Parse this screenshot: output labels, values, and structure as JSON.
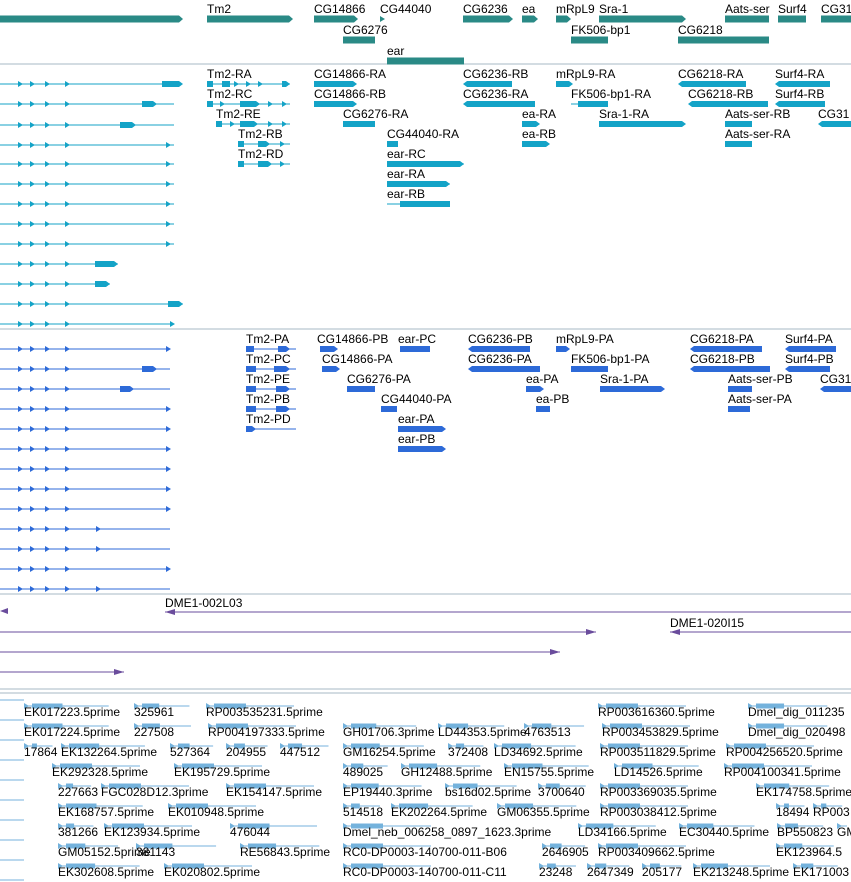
{
  "colors": {
    "gene": "#2a8a86",
    "flybase_tx": "#14a3c7",
    "predicted_tx": "#2d6ad8",
    "clone": "#6a4c9c",
    "est": "#74b2dc",
    "divider": "#a7b9c4",
    "line": "#000000"
  },
  "gene_track": {
    "labels": [
      "Tm2",
      "CG14866",
      "CG44040",
      "CG6236",
      "ea",
      "mRpL9",
      "Sra-1",
      "Aats-ser",
      "Surf4",
      "CG31",
      "CG6276",
      "FK506-bp1",
      "CG6218",
      "ear"
    ]
  },
  "flybase_track": {
    "labels": [
      "Tm2-RA",
      "CG14866-RA",
      "CG6236-RB",
      "mRpL9-RA",
      "CG6218-RA",
      "Surf4-RA",
      "Tm2-RC",
      "CG14866-RB",
      "CG6236-RA",
      "FK506-bp1-RA",
      "CG6218-RB",
      "Surf4-RB",
      "Tm2-RE",
      "CG6276-RA",
      "ea-RA",
      "Sra-1-RA",
      "Aats-ser-RB",
      "CG31",
      "Tm2-RB",
      "CG44040-RA",
      "ea-RB",
      "Aats-ser-RA",
      "Tm2-RD",
      "ear-RC",
      "ear-RA",
      "ear-RB"
    ]
  },
  "predicted_track": {
    "labels": [
      "Tm2-PA",
      "CG14866-PB",
      "ear-PC",
      "CG6236-PB",
      "mRpL9-PA",
      "CG6218-PA",
      "Surf4-PA",
      "Tm2-PC",
      "CG14866-PA",
      "CG6236-PA",
      "FK506-bp1-PA",
      "CG6218-PB",
      "Surf4-PB",
      "Tm2-PE",
      "CG6276-PA",
      "ea-PA",
      "Sra-1-PA",
      "Aats-ser-PB",
      "CG31",
      "Tm2-PB",
      "CG44040-PA",
      "ea-PB",
      "Aats-ser-PA",
      "Tm2-PD",
      "ear-PA",
      "ear-PB"
    ]
  },
  "clone_track": {
    "labels": [
      "DME1-002L03",
      "DME1-020I15"
    ]
  },
  "est_track": {
    "labels": [
      "EK017223.5prime",
      "325961",
      "RP003535231.5prime",
      "RP003616360.5prime",
      "Dmel_dig_011235",
      "EK017224.5prime",
      "227508",
      "RP004197333.5prime",
      "GH01706.3prime",
      "LD44353.5prime",
      "4763513",
      "RP003453829.5prime",
      "Dmel_dig_020498",
      "17864",
      "EK132264.5prime",
      "527364",
      "204955",
      "447512",
      "GM16254.5prime",
      "372408",
      "LD34692.5prime",
      "RP003511829.5prime",
      "RP004256520.5prime",
      "EK292328.5prime",
      "EK195729.5prime",
      "489025",
      "GH12488.5prime",
      "EN15755.5prime",
      "LD14526.5prime",
      "RP004100341.5prime",
      "227663",
      "FGC028D12.3prime",
      "EK154147.5prime",
      "EP19440.3prime",
      "bs16d02.5prime",
      "3700640",
      "RP003369035.5prime",
      "EK174758.5prime",
      "EK168757.5prime",
      "EK010948.5prime",
      "514518",
      "EK202264.5prime",
      "GM06355.5prime",
      "RP003038412.5prime",
      "18494",
      "RP003",
      "381266",
      "EK123934.5prime",
      "476044",
      "Dmel_neb_006258_0897_1623.3prime",
      "LD34166.5prime",
      "EC30440.5prime",
      "BP550823",
      "GM",
      "GM05152.5prime",
      "381143",
      "RE56843.5prime",
      "RC0-DP0003-140700-011-B06",
      "2646905",
      "RP003409662.5prime",
      "EK123964.5",
      "EK302608.5prime",
      "EK020802.5prime",
      "RC0-DP0003-140700-011-C11",
      "23248",
      "2647349",
      "205177",
      "EK213248.5prime",
      "EK171003"
    ]
  }
}
